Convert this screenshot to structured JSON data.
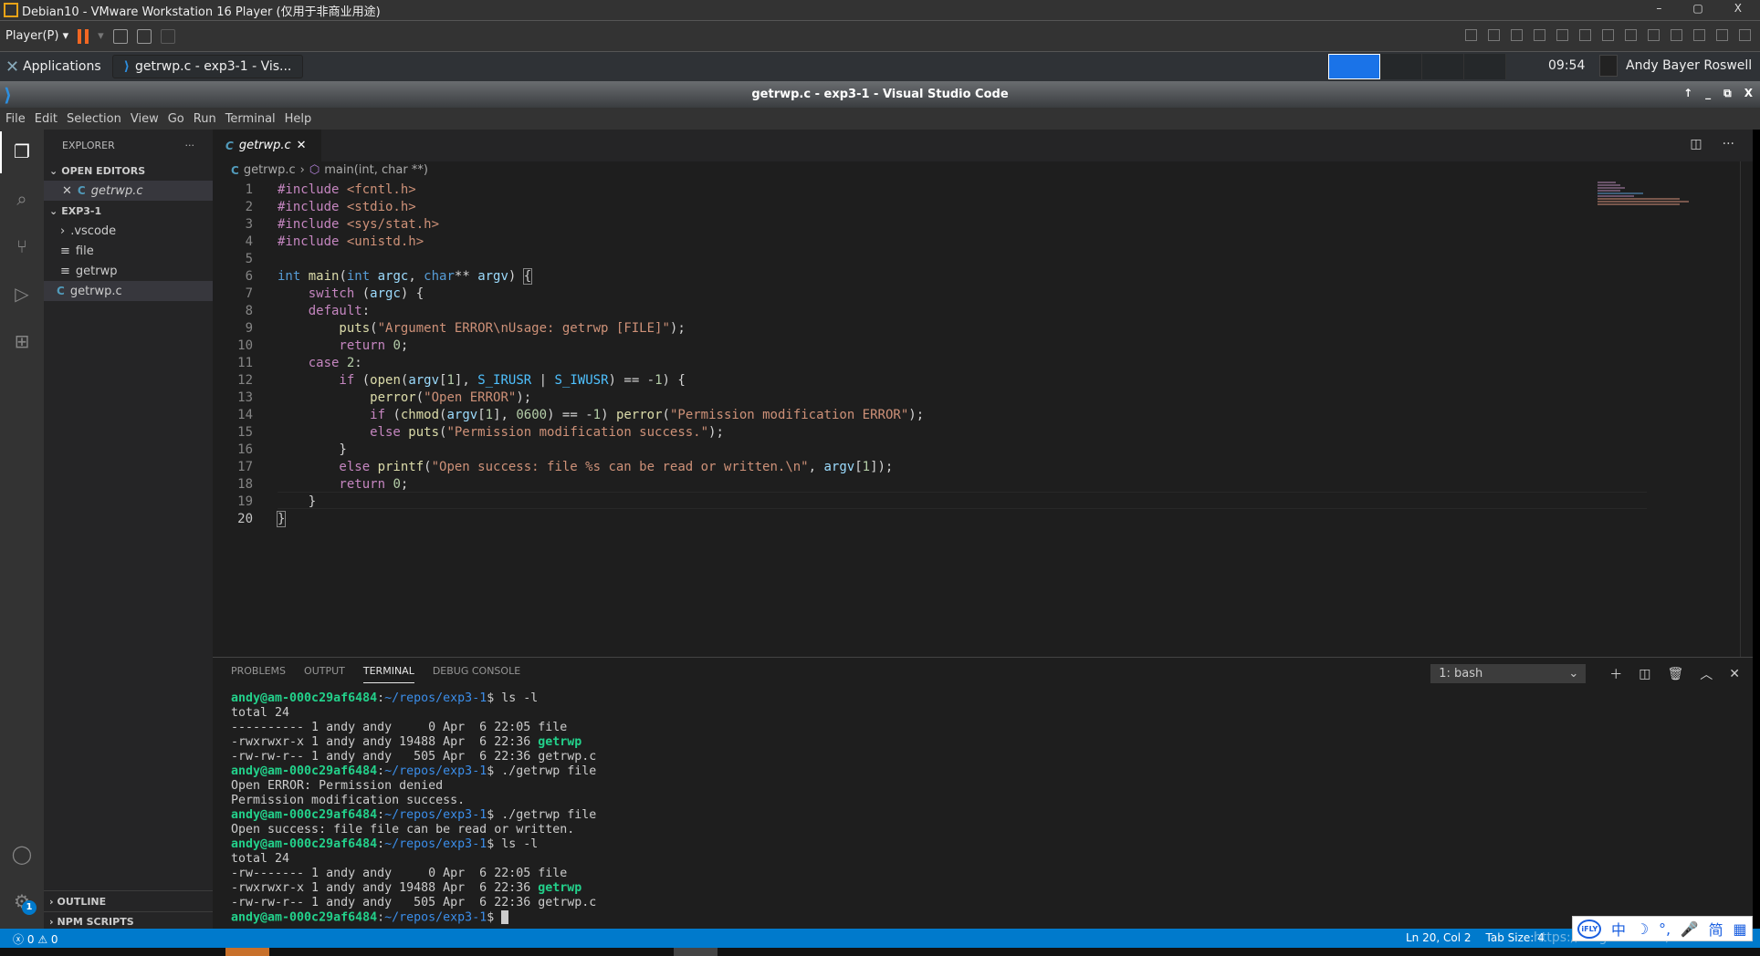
{
  "vmware": {
    "title": "Debian10 - VMware Workstation 16 Player (仅用于非商业用途)",
    "player_menu": "Player(P)",
    "window_controls": [
      "–",
      "▢",
      "X"
    ]
  },
  "taskbar": {
    "applications": "Applications",
    "task": "getrwp.c - exp3-1 - Vis...",
    "clock": "09:54",
    "user": "Andy Bayer Roswell"
  },
  "window": {
    "title": "getrwp.c - exp3-1 - Visual Studio Code",
    "controls": [
      "↑",
      "_",
      "⧉",
      "X"
    ]
  },
  "menu": [
    "File",
    "Edit",
    "Selection",
    "View",
    "Go",
    "Run",
    "Terminal",
    "Help"
  ],
  "sidebar": {
    "title": "EXPLORER",
    "more": "···",
    "open_editors": "OPEN EDITORS",
    "open_file": "getrwp.c",
    "folder": "EXP3-1",
    "items": [
      {
        "name": ".vscode",
        "type": "folder"
      },
      {
        "name": "file",
        "type": "text"
      },
      {
        "name": "getrwp",
        "type": "text"
      },
      {
        "name": "getrwp.c",
        "type": "c"
      }
    ],
    "outline": "OUTLINE",
    "npm": "NPM SCRIPTS"
  },
  "settings_badge": "1",
  "tab": {
    "label": "getrwp.c",
    "lang": "C"
  },
  "breadcrumb": {
    "file": "getrwp.c",
    "symbol": "main(int, char **)"
  },
  "code": [
    [
      [
        "#include ",
        "inc"
      ],
      [
        "<fcntl.h>",
        "str"
      ]
    ],
    [
      [
        "#include ",
        "inc"
      ],
      [
        "<stdio.h>",
        "str"
      ]
    ],
    [
      [
        "#include ",
        "inc"
      ],
      [
        "<sys/stat.h>",
        "str"
      ]
    ],
    [
      [
        "#include ",
        "inc"
      ],
      [
        "<unistd.h>",
        "str"
      ]
    ],
    [],
    [
      [
        "int ",
        "ty"
      ],
      [
        "main",
        "fn"
      ],
      [
        "(",
        "pun"
      ],
      [
        "int ",
        "ty"
      ],
      [
        "argc",
        "var"
      ],
      [
        ", ",
        "pun"
      ],
      [
        "char",
        "ty"
      ],
      [
        "** ",
        "pun"
      ],
      [
        "argv",
        "var"
      ],
      [
        ") ",
        "pun"
      ],
      [
        "{",
        "bracket"
      ]
    ],
    [
      [
        "    switch ",
        "kw"
      ],
      [
        "(",
        "pun"
      ],
      [
        "argc",
        "var"
      ],
      [
        ") {",
        "pun"
      ]
    ],
    [
      [
        "    default",
        "kw"
      ],
      [
        ":",
        "pun"
      ]
    ],
    [
      [
        "        puts",
        "fn"
      ],
      [
        "(",
        "pun"
      ],
      [
        "\"Argument ERROR\\nUsage: getrwp [FILE]\"",
        "str"
      ],
      [
        ");",
        "pun"
      ]
    ],
    [
      [
        "        return ",
        "kw"
      ],
      [
        "0",
        "num2"
      ],
      [
        ";",
        "pun"
      ]
    ],
    [
      [
        "    case ",
        "kw"
      ],
      [
        "2",
        "num2"
      ],
      [
        ":",
        "pun"
      ]
    ],
    [
      [
        "        if ",
        "kw"
      ],
      [
        "(",
        "pun"
      ],
      [
        "open",
        "fn"
      ],
      [
        "(",
        "pun"
      ],
      [
        "argv",
        "var"
      ],
      [
        "[",
        "pun"
      ],
      [
        "1",
        "num2"
      ],
      [
        "], ",
        "pun"
      ],
      [
        "S_IRUSR",
        "mac"
      ],
      [
        " | ",
        "pun"
      ],
      [
        "S_IWUSR",
        "mac"
      ],
      [
        ") == -",
        "pun"
      ],
      [
        "1",
        "num2"
      ],
      [
        ") {",
        "pun"
      ]
    ],
    [
      [
        "            perror",
        "fn"
      ],
      [
        "(",
        "pun"
      ],
      [
        "\"Open ERROR\"",
        "str"
      ],
      [
        ");",
        "pun"
      ]
    ],
    [
      [
        "            if ",
        "kw"
      ],
      [
        "(",
        "pun"
      ],
      [
        "chmod",
        "fn"
      ],
      [
        "(",
        "pun"
      ],
      [
        "argv",
        "var"
      ],
      [
        "[",
        "pun"
      ],
      [
        "1",
        "num2"
      ],
      [
        "], ",
        "pun"
      ],
      [
        "0600",
        "num2"
      ],
      [
        ") == -",
        "pun"
      ],
      [
        "1",
        "num2"
      ],
      [
        ") ",
        "pun"
      ],
      [
        "perror",
        "fn"
      ],
      [
        "(",
        "pun"
      ],
      [
        "\"Permission modification ERROR\"",
        "str"
      ],
      [
        ");",
        "pun"
      ]
    ],
    [
      [
        "            else ",
        "kw"
      ],
      [
        "puts",
        "fn"
      ],
      [
        "(",
        "pun"
      ],
      [
        "\"Permission modification success.\"",
        "str"
      ],
      [
        ");",
        "pun"
      ]
    ],
    [
      [
        "        }",
        "pun"
      ]
    ],
    [
      [
        "        else ",
        "kw"
      ],
      [
        "printf",
        "fn"
      ],
      [
        "(",
        "pun"
      ],
      [
        "\"Open success: file %s can be read or written.\\n\"",
        "str"
      ],
      [
        ", ",
        "pun"
      ],
      [
        "argv",
        "var"
      ],
      [
        "[",
        "pun"
      ],
      [
        "1",
        "num2"
      ],
      [
        "]);",
        "pun"
      ]
    ],
    [
      [
        "        return ",
        "kw"
      ],
      [
        "0",
        "num2"
      ],
      [
        ";",
        "pun"
      ]
    ],
    [
      [
        "    }",
        "pun"
      ]
    ],
    [
      [
        "}",
        "bracket"
      ]
    ]
  ],
  "current_line": 20,
  "panel": {
    "tabs": [
      "PROBLEMS",
      "OUTPUT",
      "TERMINAL",
      "DEBUG CONSOLE"
    ],
    "active": "TERMINAL",
    "terminal_select": "1: bash"
  },
  "terminal": [
    [
      [
        "andy@am-000c29af6484",
        "pu"
      ],
      [
        ":",
        "t"
      ],
      [
        "~/repos/exp3-1",
        "pp"
      ],
      [
        "$ ls -l",
        "t"
      ]
    ],
    [
      [
        "total 24",
        "t"
      ]
    ],
    [
      [
        "---------- 1 andy andy     0 Apr  6 22:05 file",
        "t"
      ]
    ],
    [
      [
        "-rwxrwxr-x 1 andy andy 19488 Apr  6 22:36 ",
        "t"
      ],
      [
        "getrwp",
        "ex"
      ]
    ],
    [
      [
        "-rw-rw-r-- 1 andy andy   505 Apr  6 22:36 getrwp.c",
        "t"
      ]
    ],
    [
      [
        "andy@am-000c29af6484",
        "pu"
      ],
      [
        ":",
        "t"
      ],
      [
        "~/repos/exp3-1",
        "pp"
      ],
      [
        "$ ./getrwp file",
        "t"
      ]
    ],
    [
      [
        "Open ERROR: Permission denied",
        "t"
      ]
    ],
    [
      [
        "Permission modification success.",
        "t"
      ]
    ],
    [
      [
        "andy@am-000c29af6484",
        "pu"
      ],
      [
        ":",
        "t"
      ],
      [
        "~/repos/exp3-1",
        "pp"
      ],
      [
        "$ ./getrwp file",
        "t"
      ]
    ],
    [
      [
        "Open success: file file can be read or written.",
        "t"
      ]
    ],
    [
      [
        "andy@am-000c29af6484",
        "pu"
      ],
      [
        ":",
        "t"
      ],
      [
        "~/repos/exp3-1",
        "pp"
      ],
      [
        "$ ls -l",
        "t"
      ]
    ],
    [
      [
        "total 24",
        "t"
      ]
    ],
    [
      [
        "-rw------- 1 andy andy     0 Apr  6 22:05 file",
        "t"
      ]
    ],
    [
      [
        "-rwxrwxr-x 1 andy andy 19488 Apr  6 22:36 ",
        "t"
      ],
      [
        "getrwp",
        "ex"
      ]
    ],
    [
      [
        "-rw-rw-r-- 1 andy andy   505 Apr  6 22:36 getrwp.c",
        "t"
      ]
    ],
    [
      [
        "andy@am-000c29af6484",
        "pu"
      ],
      [
        ":",
        "t"
      ],
      [
        "~/repos/exp3-1",
        "pp"
      ],
      [
        "$ ",
        "t"
      ],
      [
        "",
        "cursor"
      ]
    ]
  ],
  "status": {
    "errors": "0",
    "warnings": "0",
    "position": "Ln 20, Col 2",
    "tab_size": "Tab Size: 4"
  },
  "ime": [
    "iFLY",
    "中",
    "☽",
    "°,",
    "🎤",
    "简",
    "▦"
  ],
  "watermark": "https://blog.csdn.net/COFACTOR",
  "colors": {
    "accent": "#007acc",
    "terminal_green": "#23d18b",
    "terminal_blue": "#3b8eea"
  }
}
